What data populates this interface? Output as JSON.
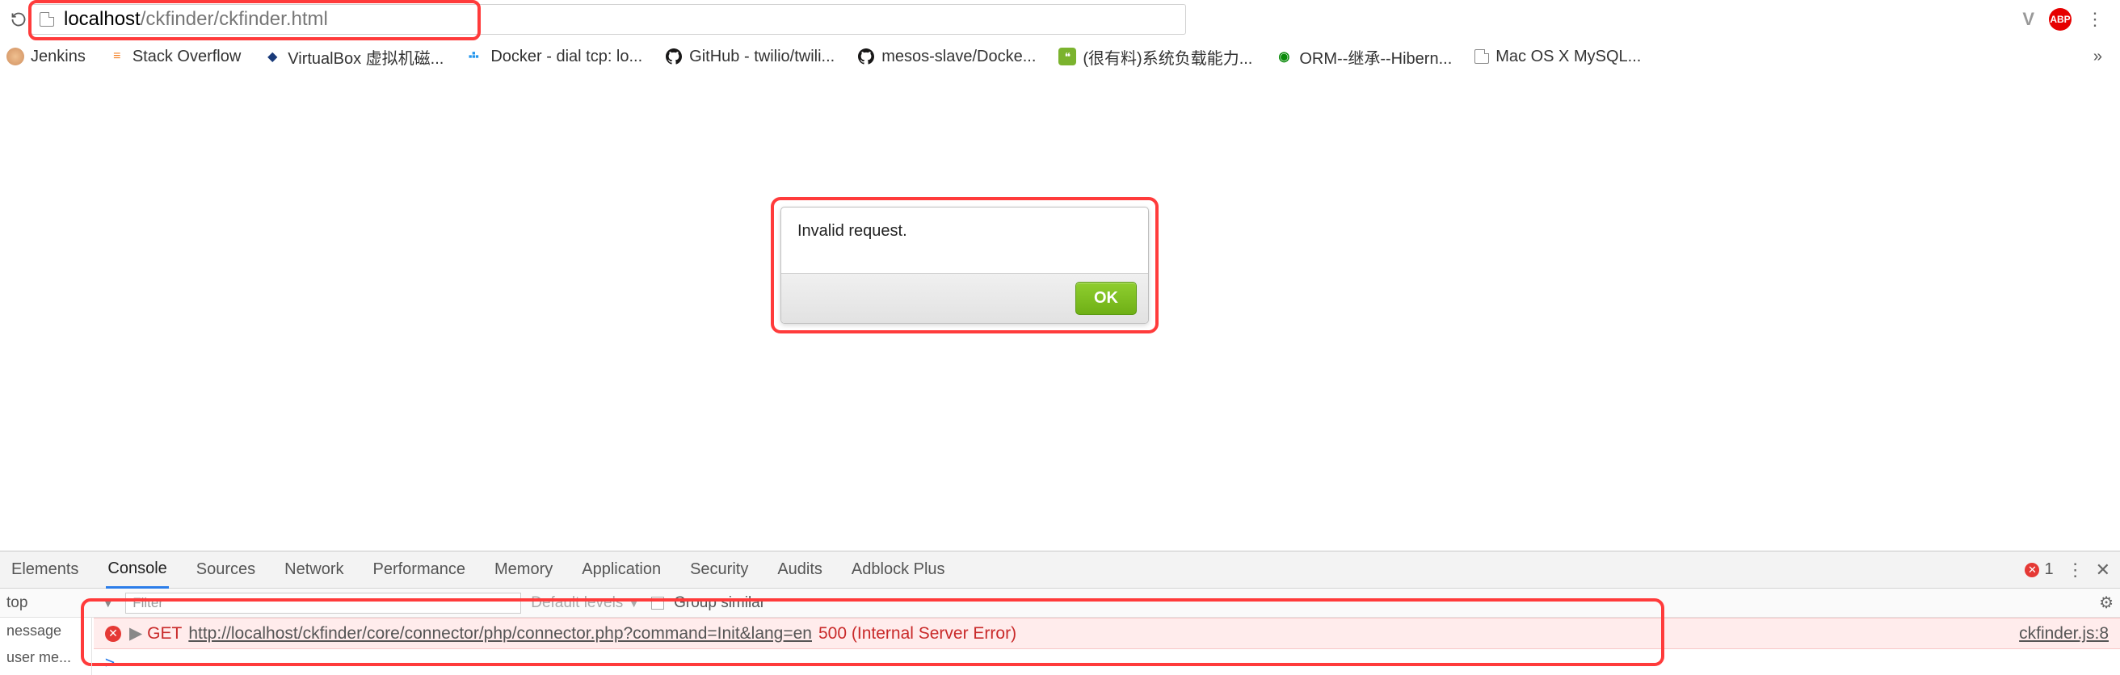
{
  "address_bar": {
    "host": "localhost",
    "path": "/ckfinder/ckfinder.html",
    "abp_label": "ABP"
  },
  "bookmarks": [
    {
      "label": "Jenkins",
      "icon": "jenkins"
    },
    {
      "label": "Stack Overflow",
      "icon": "so"
    },
    {
      "label": "VirtualBox 虚拟机磁...",
      "icon": "vb"
    },
    {
      "label": "Docker - dial tcp: lo...",
      "icon": "docker"
    },
    {
      "label": "GitHub - twilio/twili...",
      "icon": "gh"
    },
    {
      "label": "mesos-slave/Docke...",
      "icon": "gh"
    },
    {
      "label": "(很有料)系统负载能力...",
      "icon": "wechat"
    },
    {
      "label": "ORM--继承--Hibern...",
      "icon": "orm"
    },
    {
      "label": "Mac OS X MySQL...",
      "icon": "page"
    }
  ],
  "dialog": {
    "message": "Invalid request.",
    "ok": "OK"
  },
  "devtools": {
    "tabs": [
      "Elements",
      "Console",
      "Sources",
      "Network",
      "Performance",
      "Memory",
      "Application",
      "Security",
      "Audits",
      "Adblock Plus"
    ],
    "active_tab": "Console",
    "error_count": "1",
    "context": "top",
    "filter_placeholder": "Filter",
    "levels_label": "Default levels",
    "group_similar": "Group similar",
    "sidebar": [
      "nessage",
      "user me..."
    ],
    "error": {
      "verb": "GET",
      "url": "http://localhost/ckfinder/core/connector/php/connector.php?command=Init&lang=en",
      "status": "500 (Internal Server Error)",
      "source": "ckfinder.js:8"
    },
    "prompt": ">"
  }
}
